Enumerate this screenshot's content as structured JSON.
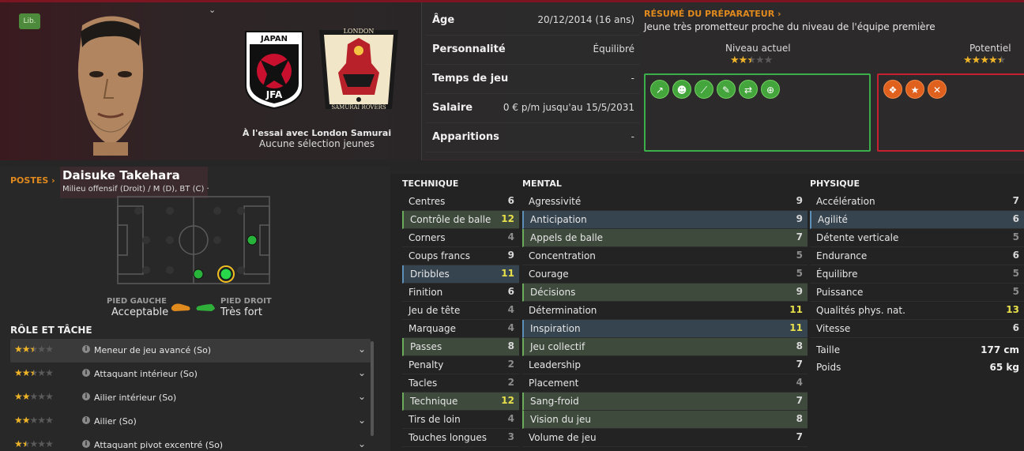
{
  "status_badge": "Lib.",
  "player": {
    "name": "Daisuke Takehara",
    "positions": "Milieu offensif (Droit) / M (D), BT (C) ·",
    "trial": "À l'essai avec London Samurai",
    "youth_caps": "Aucune sélection jeunes"
  },
  "nation": {
    "name": "JAPAN",
    "federation": "JFA"
  },
  "club": {
    "name_top": "LONDON",
    "name_bottom": "SAMURAI ROVERS"
  },
  "info": [
    {
      "label": "Âge",
      "value": "20/12/2014 (16 ans)"
    },
    {
      "label": "Personnalité",
      "value": "Équilibré"
    },
    {
      "label": "Temps de jeu",
      "value": "-"
    },
    {
      "label": "Salaire",
      "value": "0 € p/m jusqu'au 15/5/2031"
    },
    {
      "label": "Apparitions",
      "value": "-"
    }
  ],
  "resume": {
    "title": "RÉSUMÉ DU PRÉPARATEUR ›",
    "text": "Jeune très prometteur proche du niveau de l'équipe première",
    "niveau_label": "Niveau actuel",
    "potentiel_label": "Potentiel",
    "niveau_stars": 2.5,
    "potentiel_stars": 4.5
  },
  "strength_icons": [
    "chart-up-icon",
    "head-icon",
    "pill-icon",
    "wrench-icon",
    "handshake-icon",
    "globe-icon"
  ],
  "weakness_icons": [
    "footprints-icon",
    "star-icon",
    "broken-icon"
  ],
  "postes": {
    "title": "POSTES ›",
    "pied_gauche_label": "PIED GAUCHE",
    "pied_gauche": "Acceptable",
    "pied_droit_label": "PIED DROIT",
    "pied_droit": "Très fort"
  },
  "role_title": "RÔLE ET TÂCHE",
  "roles": [
    {
      "name": "Meneur de jeu avancé (So)",
      "stars": 2.5
    },
    {
      "name": "Attaquant intérieur (So)",
      "stars": 2.5
    },
    {
      "name": "Ailier intérieur (So)",
      "stars": 2
    },
    {
      "name": "Ailier (So)",
      "stars": 2
    },
    {
      "name": "Attaquant pivot excentré (So)",
      "stars": 1.5
    }
  ],
  "technique_title": "TECHNIQUE",
  "mental_title": "MENTAL",
  "physique_title": "PHYSIQUE",
  "technique": [
    {
      "name": "Centres",
      "value": "6"
    },
    {
      "name": "Contrôle de balle",
      "value": "12",
      "hl": "g"
    },
    {
      "name": "Corners",
      "value": "4"
    },
    {
      "name": "Coups francs",
      "value": "9"
    },
    {
      "name": "Dribbles",
      "value": "11",
      "hl": "b"
    },
    {
      "name": "Finition",
      "value": "6"
    },
    {
      "name": "Jeu de tête",
      "value": "4"
    },
    {
      "name": "Marquage",
      "value": "4"
    },
    {
      "name": "Passes",
      "value": "8",
      "hl": "g"
    },
    {
      "name": "Penalty",
      "value": "2"
    },
    {
      "name": "Tacles",
      "value": "2"
    },
    {
      "name": "Technique",
      "value": "12",
      "hl": "g"
    },
    {
      "name": "Tirs de loin",
      "value": "4"
    },
    {
      "name": "Touches longues",
      "value": "3"
    }
  ],
  "mental": [
    {
      "name": "Agressivité",
      "value": "9"
    },
    {
      "name": "Anticipation",
      "value": "9",
      "hl": "b"
    },
    {
      "name": "Appels de balle",
      "value": "7",
      "hl": "g"
    },
    {
      "name": "Concentration",
      "value": "5"
    },
    {
      "name": "Courage",
      "value": "5"
    },
    {
      "name": "Décisions",
      "value": "9",
      "hl": "g"
    },
    {
      "name": "Détermination",
      "value": "11"
    },
    {
      "name": "Inspiration",
      "value": "11",
      "hl": "b"
    },
    {
      "name": "Jeu collectif",
      "value": "8",
      "hl": "g"
    },
    {
      "name": "Leadership",
      "value": "7"
    },
    {
      "name": "Placement",
      "value": "4"
    },
    {
      "name": "Sang-froid",
      "value": "7",
      "hl": "g"
    },
    {
      "name": "Vision du jeu",
      "value": "8",
      "hl": "g"
    },
    {
      "name": "Volume de jeu",
      "value": "7"
    }
  ],
  "physique": [
    {
      "name": "Accélération",
      "value": "7"
    },
    {
      "name": "Agilité",
      "value": "6",
      "hl": "b"
    },
    {
      "name": "Détente verticale",
      "value": "5"
    },
    {
      "name": "Endurance",
      "value": "6"
    },
    {
      "name": "Équilibre",
      "value": "5"
    },
    {
      "name": "Puissance",
      "value": "5"
    },
    {
      "name": "Qualités phys. nat.",
      "value": "13"
    },
    {
      "name": "Vitesse",
      "value": "6"
    }
  ],
  "measures": [
    {
      "label": "Taille",
      "value": "177 cm"
    },
    {
      "label": "Poids",
      "value": "65 kg"
    }
  ]
}
